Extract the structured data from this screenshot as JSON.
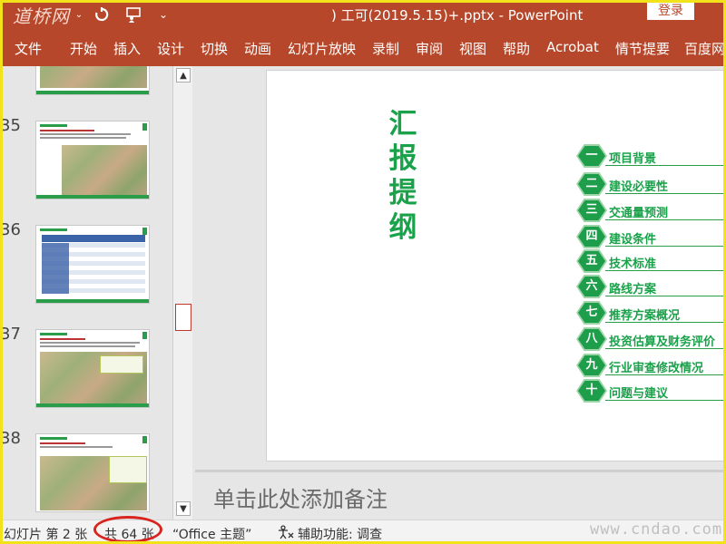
{
  "titlebar": {
    "logo_text": "道桥网",
    "title": ") 工可(2019.5.15)+.pptx  -  PowerPoint",
    "login": "登录",
    "undo_icon": "undo-icon",
    "presenter_icon": "presenter-icon",
    "customize_icon": "chevron-down-icon"
  },
  "ribbon": {
    "tabs": [
      "文件",
      "开始",
      "插入",
      "设计",
      "切换",
      "动画",
      "幻灯片放映",
      "录制",
      "审阅",
      "视图",
      "帮助",
      "Acrobat",
      "情节提要",
      "百度网"
    ]
  },
  "thumbnails": {
    "numbers": [
      "35",
      "36",
      "37",
      "38"
    ]
  },
  "slide": {
    "title": "汇报提纲",
    "agenda": [
      {
        "num": "一",
        "label": "项目背景"
      },
      {
        "num": "二",
        "label": "建设必要性"
      },
      {
        "num": "三",
        "label": "交通量预测"
      },
      {
        "num": "四",
        "label": "建设条件"
      },
      {
        "num": "五",
        "label": "技术标准"
      },
      {
        "num": "六",
        "label": "路线方案"
      },
      {
        "num": "七",
        "label": "推荐方案概况"
      },
      {
        "num": "八",
        "label": "投资估算及财务评价"
      },
      {
        "num": "九",
        "label": "行业审查修改情况"
      },
      {
        "num": "十",
        "label": "问题与建议"
      }
    ]
  },
  "notes": {
    "placeholder": "单击此处添加备注"
  },
  "statusbar": {
    "slide_info": "幻灯片 第 2 张",
    "total": "共 64 张",
    "theme": "“Office 主题”",
    "accessibility": "辅助功能: 调查"
  },
  "watermark": "www.cndao.com"
}
